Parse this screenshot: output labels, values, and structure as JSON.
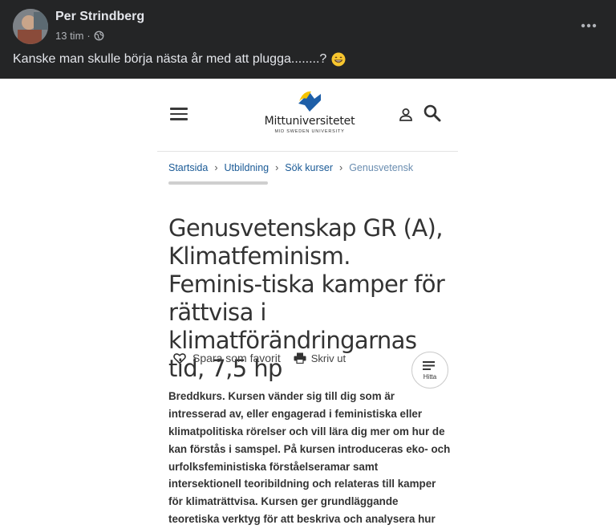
{
  "post": {
    "author": "Per Strindberg",
    "time": "13 tim",
    "separator": "·",
    "caption": "Kanske man skulle börja nästa år med att plugga........?",
    "privacy_icon": "globe-icon",
    "emoji": "grinning-face-emoji"
  },
  "site": {
    "logo_text": "Mittuniversitetet",
    "logo_sub": "MID SWEDEN UNIVERSITY",
    "logo_colors": {
      "yellow": "#f6c400",
      "blue": "#1e5fa8"
    }
  },
  "breadcrumb": [
    "Startsida",
    "Utbildning",
    "Sök kurser",
    "Genusvetensk"
  ],
  "course": {
    "title": "Genusvetenskap GR (A), Klimatfeminism. Feminis-tiska kamper för rättvisa i klimatförändringarnas tid, 7,5 hp",
    "save_favorite": "Spara som favorit",
    "print": "Skriv ut",
    "find": "Hitta",
    "description": "Breddkurs. Kursen vänder sig till dig som är intresserad av, eller engagerad i feministiska eller klimatpolitiska rörelser och vill lära dig mer om hur de kan förstås i samspel. På kursen introduceras eko- och urfolksfeministiska förståelseramar samt intersektionell teoribildning och relateras till kamper för klimaträttvisa. Kursen ger grundläggande teoretiska verktyg för att beskriva och analysera hur maktordningar såsom genus, klass, sexualitet och"
  }
}
